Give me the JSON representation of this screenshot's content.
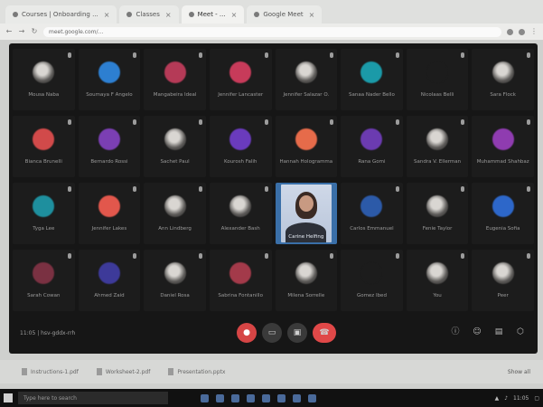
{
  "browser": {
    "tabs": [
      {
        "label": "Courses | Onboarding ..."
      },
      {
        "label": "Classes"
      },
      {
        "label": "Meet - ..."
      },
      {
        "label": "Google Meet"
      }
    ],
    "url": "meet.google.com/..."
  },
  "meeting": {
    "participants": [
      {
        "name": "Mousa Naba",
        "color": "photo"
      },
      {
        "name": "Soumaya F Angelo",
        "color": "#2d7fd1"
      },
      {
        "name": "Mangabeira Ideal",
        "color": "#b53a57"
      },
      {
        "name": "Jennifer Lancaster",
        "color": "#c73b5a"
      },
      {
        "name": "Jennifer Salazar O.",
        "color": "photo"
      },
      {
        "name": "Sanaa Nader Bello",
        "color": "#1b9aa8"
      },
      {
        "name": "Nicolaas Belli",
        "color": "#1c1c1c"
      },
      {
        "name": "Sara Flock",
        "color": "photo"
      },
      {
        "name": "Bianca Brunelli",
        "color": "#d14a4a"
      },
      {
        "name": "Bernardo Rossi",
        "color": "#7b3fb3"
      },
      {
        "name": "Sachet Paul",
        "color": "photo"
      },
      {
        "name": "Kourosh Falih",
        "color": "#6a3bbd"
      },
      {
        "name": "Hannah Hologramma",
        "color": "#e66b4a"
      },
      {
        "name": "Rana Gomi",
        "color": "#6b3bb0"
      },
      {
        "name": "Sandra V. Ellerman",
        "color": "photo"
      },
      {
        "name": "Muhammad Shahbaz",
        "color": "#8f3cb0"
      },
      {
        "name": "Tyga Lee",
        "color": "#1e8f9e"
      },
      {
        "name": "Jennifer Lakes",
        "color": "#e2574c"
      },
      {
        "name": "Ann Lindberg",
        "color": "photo"
      },
      {
        "name": "Alexander Bash",
        "color": "photo"
      },
      {
        "name": "Carine Helfing",
        "color": "video"
      },
      {
        "name": "Carlos Emmanuel",
        "color": "#2c5aa8"
      },
      {
        "name": "Fenie Taylor",
        "color": "photo"
      },
      {
        "name": "Eugenia Sofia",
        "color": "#2d67c9"
      },
      {
        "name": "Sarah Cowan",
        "color": "#7a3142"
      },
      {
        "name": "Ahmed Zaid",
        "color": "#3d3a99"
      },
      {
        "name": "Daniel Rosa",
        "color": "photo"
      },
      {
        "name": "Sabrina Fontanillo",
        "color": "#a33a4a"
      },
      {
        "name": "Milena Sorrelle",
        "color": "photo"
      },
      {
        "name": "Gomez Ibed",
        "color": "#1c1c1c"
      },
      {
        "name": "You",
        "color": "photo"
      },
      {
        "name": "Peer",
        "color": "photo"
      }
    ],
    "time_code": "11:05 | hsv-gddx-rrh"
  },
  "downloads": [
    {
      "label": "Instructions-1.pdf"
    },
    {
      "label": "Worksheet-2.pdf"
    },
    {
      "label": "Presentation.pptx"
    }
  ],
  "downloads_show_all": "Show all",
  "taskbar": {
    "search_placeholder": "Type here to search",
    "clock": "11:05"
  }
}
